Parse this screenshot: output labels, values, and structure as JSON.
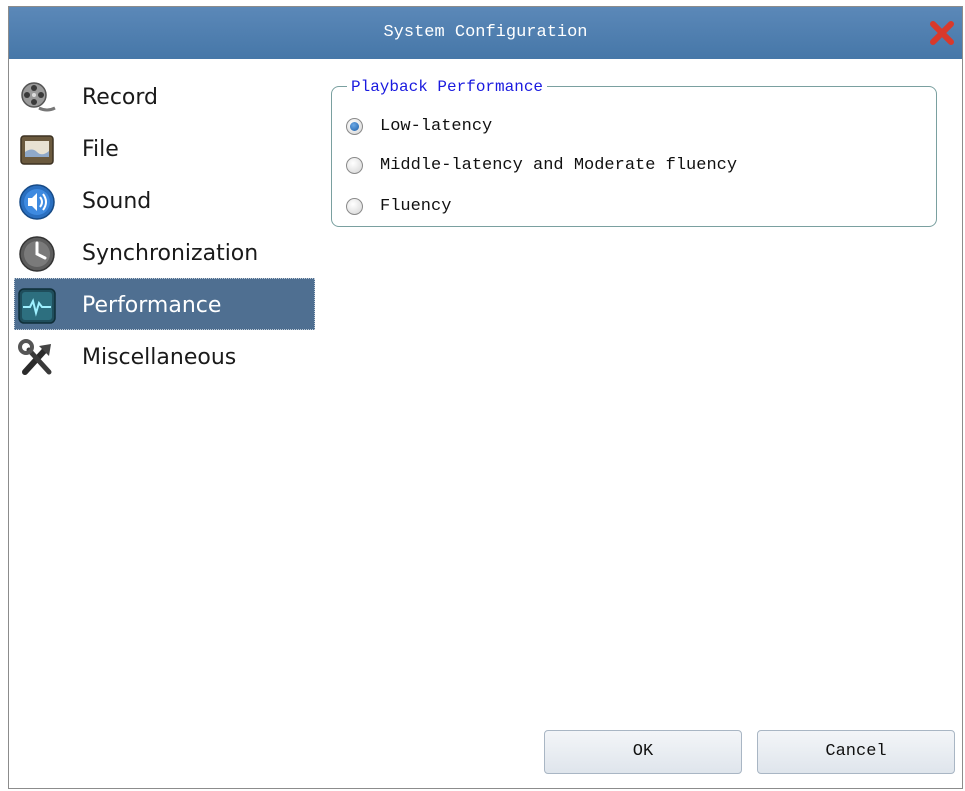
{
  "window": {
    "title": "System Configuration"
  },
  "sidebar": {
    "items": [
      {
        "label": "Record",
        "icon": "film-reel-icon"
      },
      {
        "label": "File",
        "icon": "folder-file-icon"
      },
      {
        "label": "Sound",
        "icon": "speaker-icon"
      },
      {
        "label": "Synchronization",
        "icon": "clock-icon"
      },
      {
        "label": "Performance",
        "icon": "pulse-monitor-icon",
        "selected": true
      },
      {
        "label": "Miscellaneous",
        "icon": "tools-icon"
      }
    ]
  },
  "playback": {
    "group_title": "Playback Performance",
    "options": [
      {
        "label": "Low-latency",
        "checked": true
      },
      {
        "label": "Middle-latency and Moderate fluency",
        "checked": false
      },
      {
        "label": "Fluency",
        "checked": false
      }
    ]
  },
  "buttons": {
    "ok": "OK",
    "cancel": "Cancel"
  },
  "colors": {
    "titlebar": "#4f7fb0",
    "selection": "#4f6f91",
    "close": "#d9392b",
    "group_title": "#1a1adf"
  }
}
